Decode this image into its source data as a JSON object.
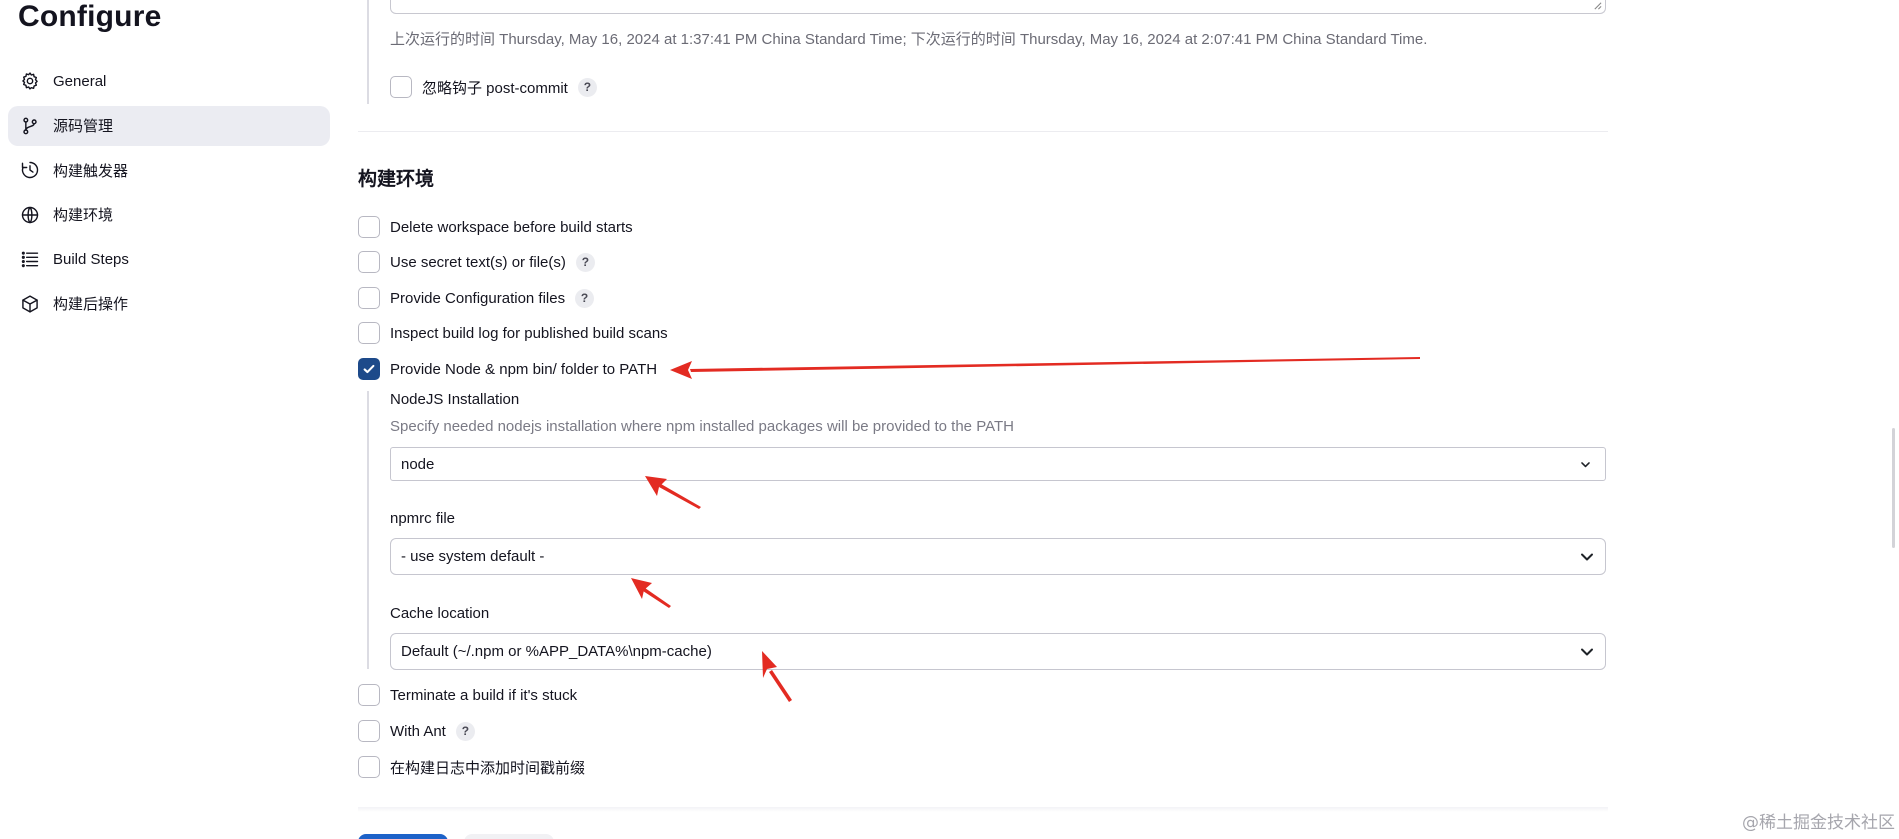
{
  "page": {
    "title": "Configure"
  },
  "sidebar": {
    "items": [
      {
        "label": "General",
        "icon": "gear-icon",
        "active": false
      },
      {
        "label": "源码管理",
        "icon": "git-branch-icon",
        "active": true
      },
      {
        "label": "构建触发器",
        "icon": "clock-icon",
        "active": false
      },
      {
        "label": "构建环境",
        "icon": "globe-icon",
        "active": false
      },
      {
        "label": "Build Steps",
        "icon": "list-icon",
        "active": false
      },
      {
        "label": "构建后操作",
        "icon": "cube-icon",
        "active": false
      }
    ]
  },
  "trigger": {
    "schedule_text": "上次运行的时间 Thursday, May 16, 2024 at 1:37:41 PM China Standard Time; 下次运行的时间 Thursday, May 16, 2024 at 2:07:41 PM China Standard Time.",
    "ignore_post_commit": {
      "label": "忽略钩子 post-commit",
      "checked": false
    }
  },
  "build_env": {
    "title": "构建环境",
    "options": [
      {
        "label": "Delete workspace before build starts",
        "checked": false,
        "help": false
      },
      {
        "label": "Use secret text(s) or file(s)",
        "checked": false,
        "help": true
      },
      {
        "label": "Provide Configuration files",
        "checked": false,
        "help": true
      },
      {
        "label": "Inspect build log for published build scans",
        "checked": false,
        "help": false
      },
      {
        "label": "Provide Node & npm bin/ folder to PATH",
        "checked": true,
        "help": false
      }
    ],
    "node": {
      "installation_label": "NodeJS Installation",
      "installation_desc": "Specify needed nodejs installation where npm installed packages will be provided to the PATH",
      "installation_value": "node",
      "npmrc_label": "npmrc file",
      "npmrc_value": "- use system default -",
      "cache_label": "Cache location",
      "cache_value": "Default (~/.npm or %APP_DATA%\\npm-cache)"
    },
    "options_after": [
      {
        "label": "Terminate a build if it's stuck",
        "checked": false,
        "help": false
      },
      {
        "label": "With Ant",
        "checked": false,
        "help": true
      },
      {
        "label": "在构建日志中添加时间戳前缀",
        "checked": false,
        "help": false
      }
    ]
  },
  "help_symbol": "?",
  "watermark": "@稀土掘金技术社区",
  "colors": {
    "accent": "#1d4a8a",
    "annotation_arrow": "#e32b22",
    "active_bg": "#ebecf2"
  }
}
